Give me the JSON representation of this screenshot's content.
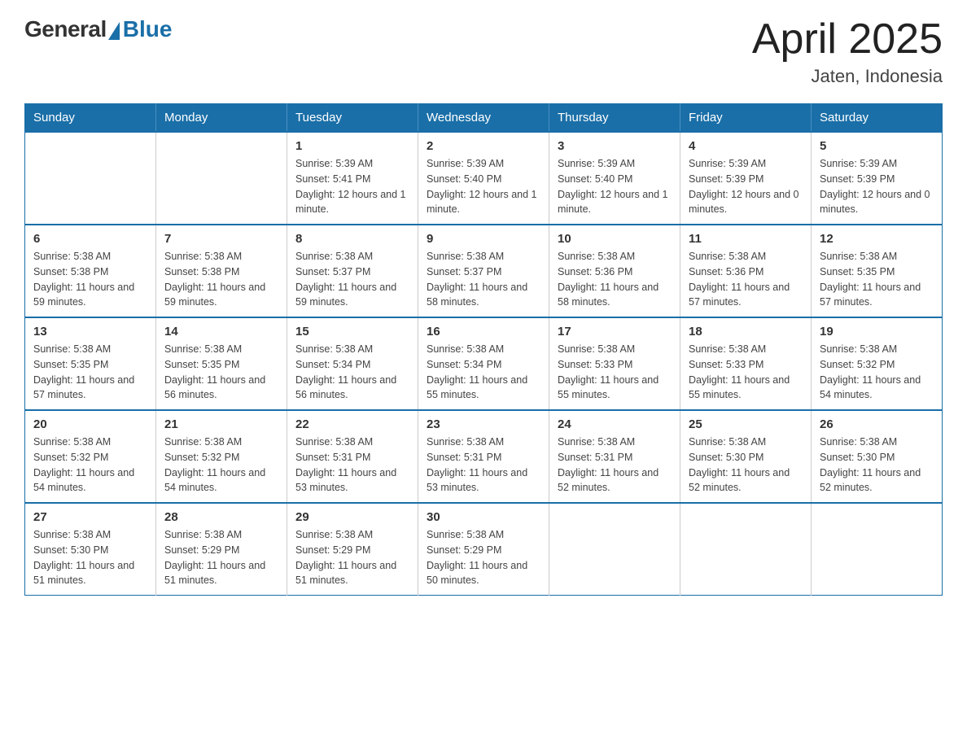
{
  "logo": {
    "general": "General",
    "blue": "Blue"
  },
  "title": {
    "month_year": "April 2025",
    "location": "Jaten, Indonesia"
  },
  "headers": [
    "Sunday",
    "Monday",
    "Tuesday",
    "Wednesday",
    "Thursday",
    "Friday",
    "Saturday"
  ],
  "weeks": [
    [
      {
        "day": "",
        "info": ""
      },
      {
        "day": "",
        "info": ""
      },
      {
        "day": "1",
        "info": "Sunrise: 5:39 AM\nSunset: 5:41 PM\nDaylight: 12 hours and 1 minute."
      },
      {
        "day": "2",
        "info": "Sunrise: 5:39 AM\nSunset: 5:40 PM\nDaylight: 12 hours and 1 minute."
      },
      {
        "day": "3",
        "info": "Sunrise: 5:39 AM\nSunset: 5:40 PM\nDaylight: 12 hours and 1 minute."
      },
      {
        "day": "4",
        "info": "Sunrise: 5:39 AM\nSunset: 5:39 PM\nDaylight: 12 hours and 0 minutes."
      },
      {
        "day": "5",
        "info": "Sunrise: 5:39 AM\nSunset: 5:39 PM\nDaylight: 12 hours and 0 minutes."
      }
    ],
    [
      {
        "day": "6",
        "info": "Sunrise: 5:38 AM\nSunset: 5:38 PM\nDaylight: 11 hours and 59 minutes."
      },
      {
        "day": "7",
        "info": "Sunrise: 5:38 AM\nSunset: 5:38 PM\nDaylight: 11 hours and 59 minutes."
      },
      {
        "day": "8",
        "info": "Sunrise: 5:38 AM\nSunset: 5:37 PM\nDaylight: 11 hours and 59 minutes."
      },
      {
        "day": "9",
        "info": "Sunrise: 5:38 AM\nSunset: 5:37 PM\nDaylight: 11 hours and 58 minutes."
      },
      {
        "day": "10",
        "info": "Sunrise: 5:38 AM\nSunset: 5:36 PM\nDaylight: 11 hours and 58 minutes."
      },
      {
        "day": "11",
        "info": "Sunrise: 5:38 AM\nSunset: 5:36 PM\nDaylight: 11 hours and 57 minutes."
      },
      {
        "day": "12",
        "info": "Sunrise: 5:38 AM\nSunset: 5:35 PM\nDaylight: 11 hours and 57 minutes."
      }
    ],
    [
      {
        "day": "13",
        "info": "Sunrise: 5:38 AM\nSunset: 5:35 PM\nDaylight: 11 hours and 57 minutes."
      },
      {
        "day": "14",
        "info": "Sunrise: 5:38 AM\nSunset: 5:35 PM\nDaylight: 11 hours and 56 minutes."
      },
      {
        "day": "15",
        "info": "Sunrise: 5:38 AM\nSunset: 5:34 PM\nDaylight: 11 hours and 56 minutes."
      },
      {
        "day": "16",
        "info": "Sunrise: 5:38 AM\nSunset: 5:34 PM\nDaylight: 11 hours and 55 minutes."
      },
      {
        "day": "17",
        "info": "Sunrise: 5:38 AM\nSunset: 5:33 PM\nDaylight: 11 hours and 55 minutes."
      },
      {
        "day": "18",
        "info": "Sunrise: 5:38 AM\nSunset: 5:33 PM\nDaylight: 11 hours and 55 minutes."
      },
      {
        "day": "19",
        "info": "Sunrise: 5:38 AM\nSunset: 5:32 PM\nDaylight: 11 hours and 54 minutes."
      }
    ],
    [
      {
        "day": "20",
        "info": "Sunrise: 5:38 AM\nSunset: 5:32 PM\nDaylight: 11 hours and 54 minutes."
      },
      {
        "day": "21",
        "info": "Sunrise: 5:38 AM\nSunset: 5:32 PM\nDaylight: 11 hours and 54 minutes."
      },
      {
        "day": "22",
        "info": "Sunrise: 5:38 AM\nSunset: 5:31 PM\nDaylight: 11 hours and 53 minutes."
      },
      {
        "day": "23",
        "info": "Sunrise: 5:38 AM\nSunset: 5:31 PM\nDaylight: 11 hours and 53 minutes."
      },
      {
        "day": "24",
        "info": "Sunrise: 5:38 AM\nSunset: 5:31 PM\nDaylight: 11 hours and 52 minutes."
      },
      {
        "day": "25",
        "info": "Sunrise: 5:38 AM\nSunset: 5:30 PM\nDaylight: 11 hours and 52 minutes."
      },
      {
        "day": "26",
        "info": "Sunrise: 5:38 AM\nSunset: 5:30 PM\nDaylight: 11 hours and 52 minutes."
      }
    ],
    [
      {
        "day": "27",
        "info": "Sunrise: 5:38 AM\nSunset: 5:30 PM\nDaylight: 11 hours and 51 minutes."
      },
      {
        "day": "28",
        "info": "Sunrise: 5:38 AM\nSunset: 5:29 PM\nDaylight: 11 hours and 51 minutes."
      },
      {
        "day": "29",
        "info": "Sunrise: 5:38 AM\nSunset: 5:29 PM\nDaylight: 11 hours and 51 minutes."
      },
      {
        "day": "30",
        "info": "Sunrise: 5:38 AM\nSunset: 5:29 PM\nDaylight: 11 hours and 50 minutes."
      },
      {
        "day": "",
        "info": ""
      },
      {
        "day": "",
        "info": ""
      },
      {
        "day": "",
        "info": ""
      }
    ]
  ]
}
